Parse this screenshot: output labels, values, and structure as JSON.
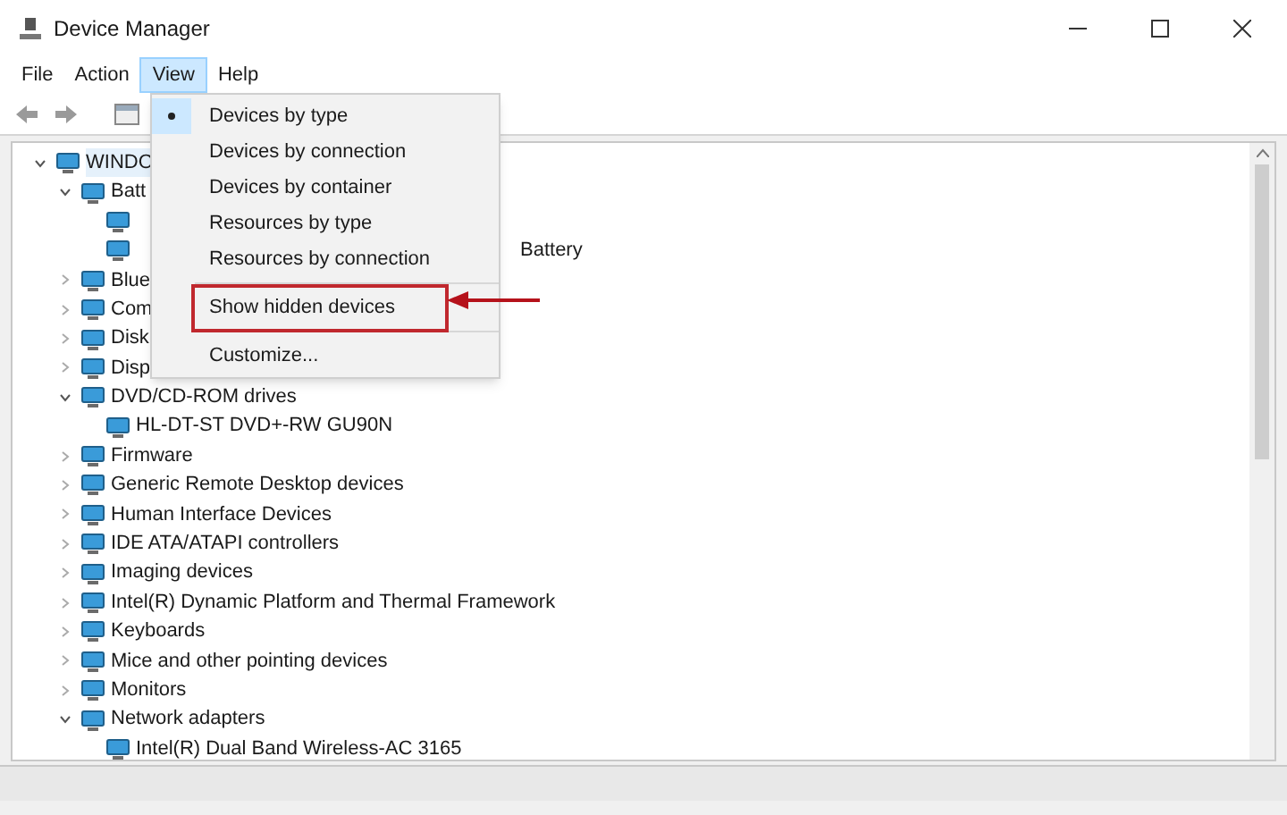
{
  "window": {
    "title": "Device Manager"
  },
  "menu_bar": [
    {
      "label": "File",
      "selected": false
    },
    {
      "label": "Action",
      "selected": false
    },
    {
      "label": "View",
      "selected": true
    },
    {
      "label": "Help",
      "selected": false
    }
  ],
  "view_menu": [
    {
      "label": "Devices by type",
      "checked": true,
      "highlighted": false
    },
    {
      "label": "Devices by connection",
      "checked": false,
      "highlighted": false
    },
    {
      "label": "Devices by container",
      "checked": false,
      "highlighted": false
    },
    {
      "label": "Resources by type",
      "checked": false,
      "highlighted": false
    },
    {
      "label": "Resources by connection",
      "checked": false,
      "highlighted": false
    },
    {
      "label": "Show hidden devices",
      "checked": false,
      "highlighted": true
    },
    {
      "label": "Customize...",
      "checked": false,
      "highlighted": false
    }
  ],
  "tree": [
    {
      "label": "WINDO",
      "selected": true,
      "expanded": true,
      "children": [
        {
          "label": "Batt",
          "selected": false,
          "expanded": true,
          "children": [
            {
              "kind": "covered"
            },
            {
              "kind": "covered",
              "tail": "Battery"
            }
          ]
        },
        {
          "label": "Blue",
          "selected": false,
          "expanded": false
        },
        {
          "label": "Com",
          "selected": false,
          "expanded": false
        },
        {
          "label": "Disk",
          "selected": false,
          "expanded": false
        },
        {
          "label": "Disp",
          "selected": false,
          "expanded": false
        },
        {
          "label": "DVD/CD-ROM drives",
          "selected": false,
          "expanded": true,
          "children": [
            {
              "label": "HL-DT-ST DVD+-RW GU90N",
              "selected": false
            }
          ]
        },
        {
          "label": "Firmware",
          "selected": false,
          "expanded": false
        },
        {
          "label": "Generic Remote Desktop devices",
          "selected": false,
          "expanded": false
        },
        {
          "label": "Human Interface Devices",
          "selected": false,
          "expanded": false
        },
        {
          "label": "IDE ATA/ATAPI controllers",
          "selected": false,
          "expanded": false
        },
        {
          "label": "Imaging devices",
          "selected": false,
          "expanded": false
        },
        {
          "label": "Intel(R) Dynamic Platform and Thermal Framework",
          "selected": false,
          "expanded": false
        },
        {
          "label": "Keyboards",
          "selected": false,
          "expanded": false
        },
        {
          "label": "Mice and other pointing devices",
          "selected": false,
          "expanded": false
        },
        {
          "label": "Monitors",
          "selected": false,
          "expanded": false
        },
        {
          "label": "Network adapters",
          "selected": false,
          "expanded": true,
          "children": [
            {
              "label": "Intel(R) Dual Band Wireless-AC 3165",
              "selected": false
            }
          ]
        }
      ]
    }
  ]
}
